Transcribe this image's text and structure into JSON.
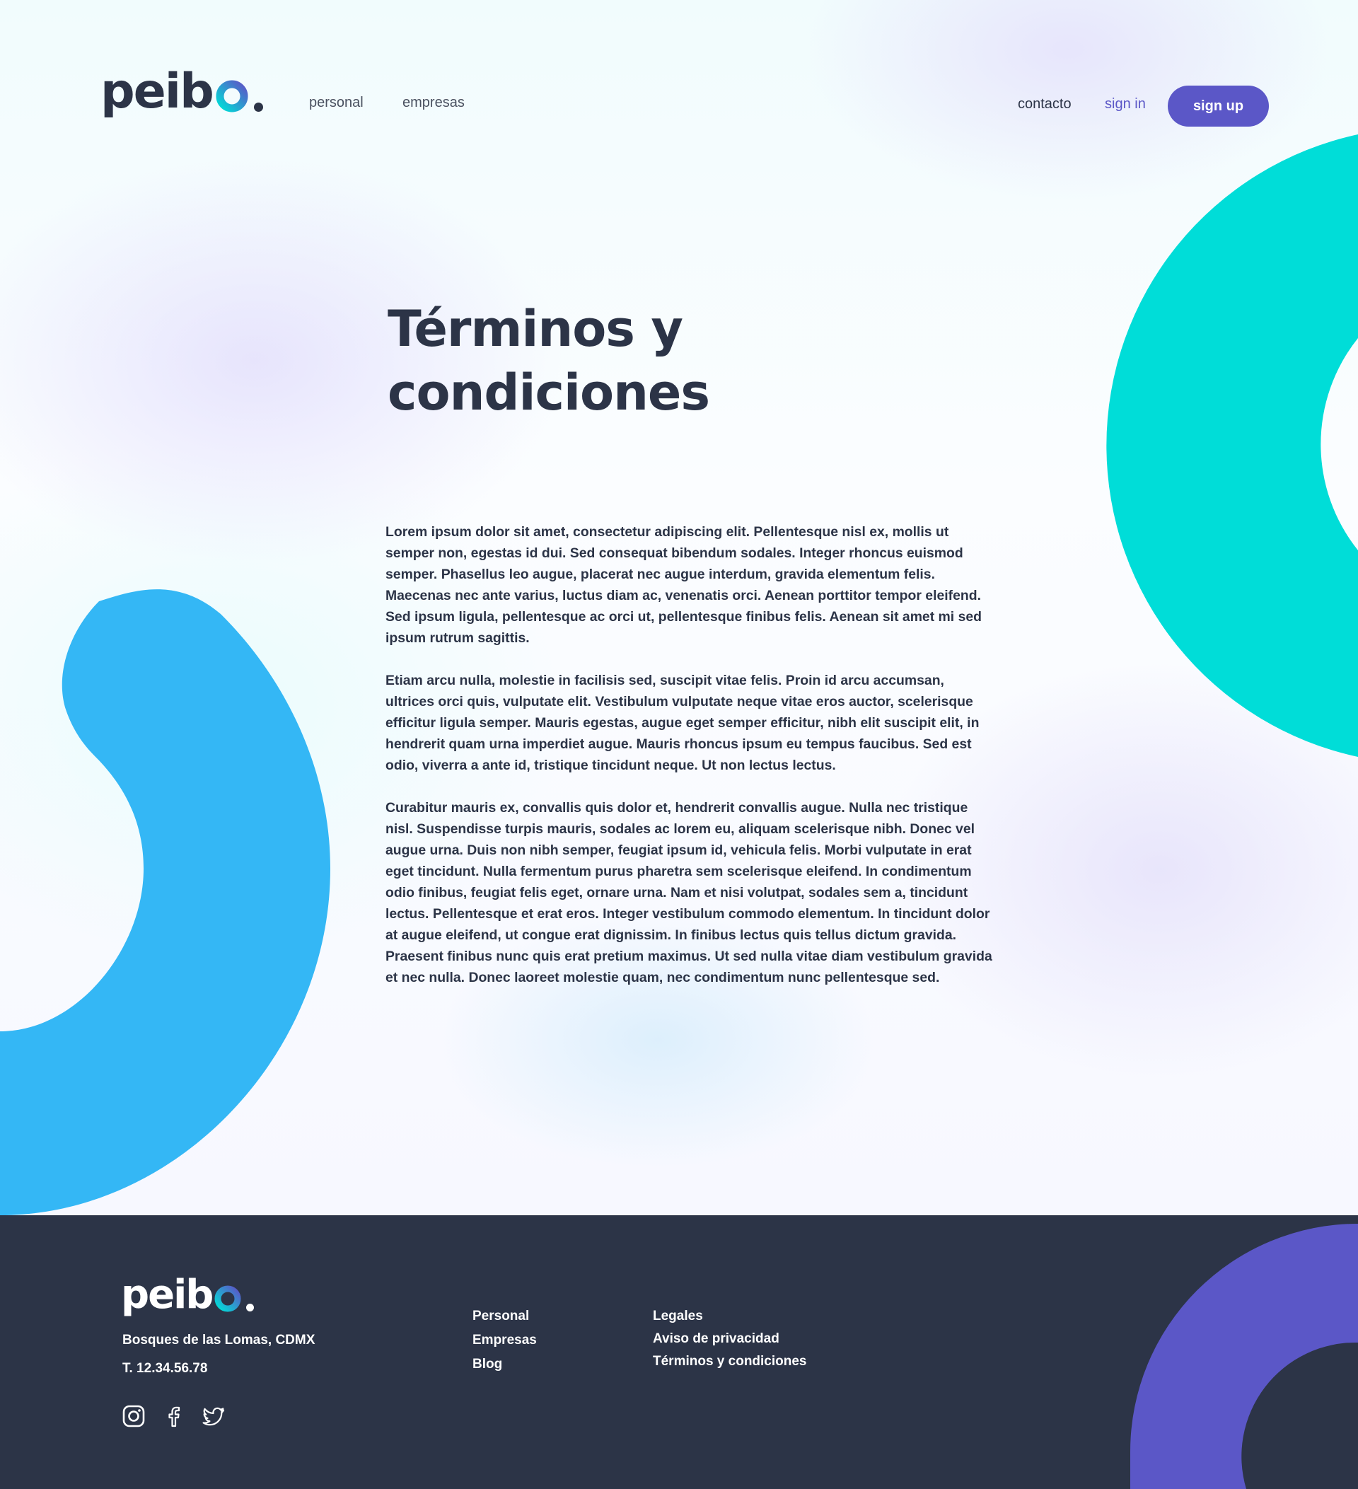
{
  "brand": {
    "name": "peibo"
  },
  "nav": {
    "left": [
      {
        "label": "personal"
      },
      {
        "label": "empresas"
      }
    ],
    "contact": "contacto",
    "sign_in": "sign in",
    "sign_up": "sign up"
  },
  "page": {
    "title_line1": "Términos y",
    "title_line2": "condiciones",
    "paragraphs": [
      "Lorem ipsum dolor sit amet, consectetur adipiscing elit. Pellentesque nisl ex, mollis ut semper non, egestas id dui. Sed consequat bibendum sodales. Integer rhoncus euismod semper. Phasellus leo augue, placerat nec augue interdum, gravida elementum felis. Maecenas nec ante varius, luctus diam ac, venenatis orci. Aenean porttitor tempor eleifend. Sed ipsum ligula, pellentesque ac orci ut, pellentesque finibus felis. Aenean sit amet mi sed ipsum rutrum sagittis.",
      "Etiam arcu nulla, molestie in facilisis sed, suscipit vitae felis. Proin id arcu accumsan, ultrices orci quis, vulputate elit. Vestibulum vulputate neque vitae eros auctor, scelerisque efficitur ligula semper. Mauris egestas, augue eget semper efficitur, nibh elit suscipit elit, in hendrerit quam urna imperdiet augue. Mauris rhoncus ipsum eu tempus faucibus. Sed est odio, viverra a ante id, tristique tincidunt neque. Ut non lectus lectus.",
      "Curabitur mauris ex, convallis quis dolor et, hendrerit convallis augue. Nulla nec tristique nisl. Suspendisse turpis mauris, sodales ac lorem eu, aliquam scelerisque nibh. Donec vel augue urna. Duis non nibh semper, feugiat ipsum id, vehicula felis. Morbi vulputate in erat eget tincidunt. Nulla fermentum purus pharetra sem scelerisque eleifend. In condimentum odio finibus, feugiat felis eget, ornare urna. Nam et nisi volutpat, sodales sem a, tincidunt lectus. Pellentesque et erat eros. Integer vestibulum commodo elementum. In tincidunt dolor at augue eleifend, ut congue erat dignissim. In finibus lectus quis tellus dictum gravida. Praesent finibus nunc quis erat pretium maximus. Ut sed nulla vitae diam vestibulum gravida et nec nulla. Donec laoreet molestie quam, nec condimentum nunc pellentesque sed."
    ]
  },
  "footer": {
    "address": "Bosques de las Lomas, CDMX",
    "phone": "T. 12.34.56.78",
    "col1": [
      "Personal",
      "Empresas",
      "Blog"
    ],
    "col2": [
      "Legales",
      "Aviso de privacidad",
      "Términos y condiciones"
    ],
    "social": [
      "instagram-icon",
      "facebook-icon",
      "twitter-icon"
    ]
  },
  "colors": {
    "dark": "#2c3447",
    "accent": "#5b57c7",
    "turquoise": "#00ddd8",
    "sky_blue": "#34b7f5"
  }
}
